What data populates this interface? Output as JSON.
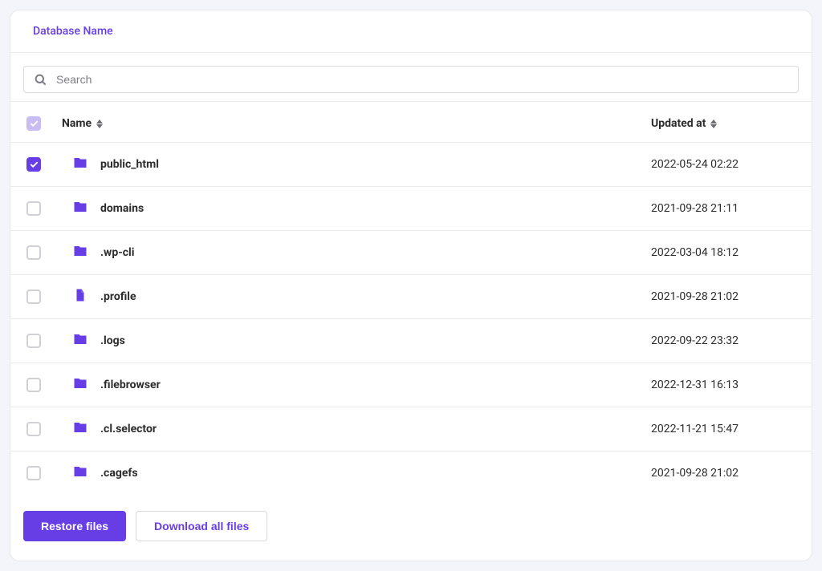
{
  "header": {
    "breadcrumb": "Database Name"
  },
  "search": {
    "placeholder": "Search",
    "value": ""
  },
  "columns": {
    "name": "Name",
    "updated": "Updated at"
  },
  "files": [
    {
      "name": "public_html",
      "type": "folder",
      "updated": "2022-05-24 02:22",
      "checked": true
    },
    {
      "name": "domains",
      "type": "folder",
      "updated": "2021-09-28 21:11",
      "checked": false
    },
    {
      "name": ".wp-cli",
      "type": "folder",
      "updated": "2022-03-04 18:12",
      "checked": false
    },
    {
      "name": ".profile",
      "type": "file",
      "updated": "2021-09-28 21:02",
      "checked": false
    },
    {
      "name": ".logs",
      "type": "folder",
      "updated": "2022-09-22 23:32",
      "checked": false
    },
    {
      "name": ".filebrowser",
      "type": "folder",
      "updated": "2022-12-31 16:13",
      "checked": false
    },
    {
      "name": ".cl.selector",
      "type": "folder",
      "updated": "2022-11-21 15:47",
      "checked": false
    },
    {
      "name": ".cagefs",
      "type": "folder",
      "updated": "2021-09-28 21:02",
      "checked": false
    }
  ],
  "actions": {
    "restore": "Restore files",
    "download": "Download all files"
  }
}
